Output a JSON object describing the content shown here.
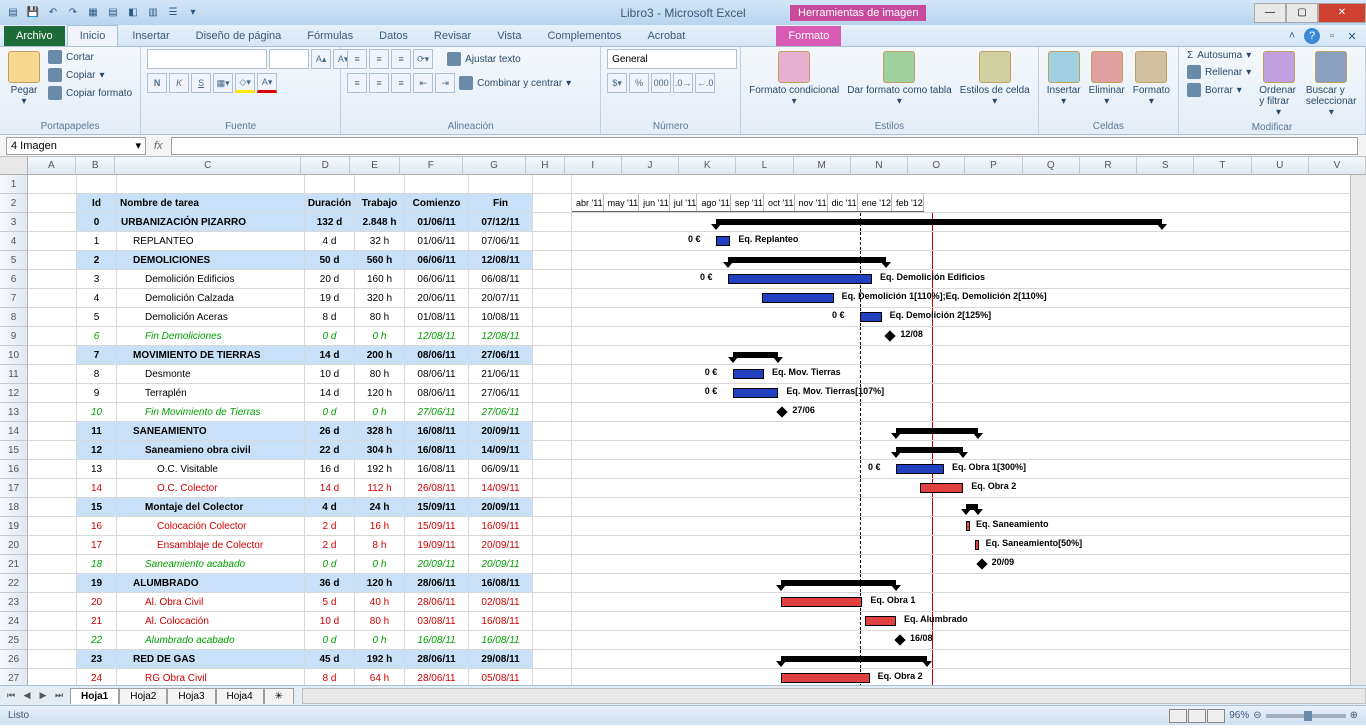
{
  "app": {
    "title": "Libro3 - Microsoft Excel",
    "tools_tab": "Herramientas de imagen"
  },
  "tabs": {
    "file": "Archivo",
    "list": [
      "Inicio",
      "Insertar",
      "Diseño de página",
      "Fórmulas",
      "Datos",
      "Revisar",
      "Vista",
      "Complementos",
      "Acrobat"
    ],
    "contextual": "Formato"
  },
  "ribbon": {
    "clipboard": {
      "paste": "Pegar",
      "cut": "Cortar",
      "copy": "Copiar",
      "format_painter": "Copiar formato",
      "label": "Portapapeles"
    },
    "font": {
      "label": "Fuente"
    },
    "alignment": {
      "wrap": "Ajustar texto",
      "merge": "Combinar y centrar",
      "label": "Alineación"
    },
    "number": {
      "format": "General",
      "label": "Número"
    },
    "styles": {
      "cond": "Formato condicional",
      "table": "Dar formato como tabla",
      "cell": "Estilos de celda",
      "label": "Estilos"
    },
    "cells": {
      "insert": "Insertar",
      "delete": "Eliminar",
      "format": "Formato",
      "label": "Celdas"
    },
    "editing": {
      "autosum": "Autosuma",
      "fill": "Rellenar",
      "clear": "Borrar",
      "sort": "Ordenar y filtrar",
      "find": "Buscar y seleccionar",
      "label": "Modificar"
    }
  },
  "namebox": "4 Imagen",
  "fx": "fx",
  "columns": [
    "A",
    "B",
    "C",
    "D",
    "E",
    "F",
    "G",
    "H",
    "I",
    "J",
    "K",
    "L",
    "M",
    "N",
    "O",
    "P",
    "Q",
    "R",
    "S",
    "T",
    "U",
    "V"
  ],
  "tbl_header": {
    "id": "Id",
    "name": "Nombre de tarea",
    "dur": "Duración",
    "work": "Trabajo",
    "start": "Comienzo",
    "fin": "Fin"
  },
  "tasks": [
    {
      "r": 3,
      "id": "0",
      "name": "URBANIZACIÓN PIZARRO",
      "dur": "132 d",
      "work": "2.848 h",
      "start": "01/06/11",
      "fin": "07/12/11",
      "cls": "grp-blue",
      "indent": 0
    },
    {
      "r": 4,
      "id": "1",
      "name": "REPLANTEO",
      "dur": "4 d",
      "work": "32 h",
      "start": "01/06/11",
      "fin": "07/06/11",
      "cls": "",
      "indent": 1
    },
    {
      "r": 5,
      "id": "2",
      "name": "DEMOLICIONES",
      "dur": "50 d",
      "work": "560 h",
      "start": "06/06/11",
      "fin": "12/08/11",
      "cls": "grp-blue",
      "indent": 1
    },
    {
      "r": 6,
      "id": "3",
      "name": "Demolición Edificios",
      "dur": "20 d",
      "work": "160 h",
      "start": "06/06/11",
      "fin": "06/08/11",
      "cls": "",
      "indent": 2
    },
    {
      "r": 7,
      "id": "4",
      "name": "Demolición Calzada",
      "dur": "19 d",
      "work": "320 h",
      "start": "20/06/11",
      "fin": "20/07/11",
      "cls": "",
      "indent": 2
    },
    {
      "r": 8,
      "id": "5",
      "name": "Demolición Aceras",
      "dur": "8 d",
      "work": "80 h",
      "start": "01/08/11",
      "fin": "10/08/11",
      "cls": "",
      "indent": 2
    },
    {
      "r": 9,
      "id": "6",
      "name": "Fin Demoliciones",
      "dur": "0 d",
      "work": "0 h",
      "start": "12/08/11",
      "fin": "12/08/11",
      "cls": "txt-green",
      "indent": 2
    },
    {
      "r": 10,
      "id": "7",
      "name": "MOVIMIENTO DE TIERRAS",
      "dur": "14 d",
      "work": "200 h",
      "start": "08/06/11",
      "fin": "27/06/11",
      "cls": "grp-blue",
      "indent": 1
    },
    {
      "r": 11,
      "id": "8",
      "name": "Desmonte",
      "dur": "10 d",
      "work": "80 h",
      "start": "08/06/11",
      "fin": "21/06/11",
      "cls": "",
      "indent": 2
    },
    {
      "r": 12,
      "id": "9",
      "name": "Terraplén",
      "dur": "14 d",
      "work": "120 h",
      "start": "08/06/11",
      "fin": "27/06/11",
      "cls": "",
      "indent": 2
    },
    {
      "r": 13,
      "id": "10",
      "name": "Fin Movimiento de Tierras",
      "dur": "0 d",
      "work": "0 h",
      "start": "27/06/11",
      "fin": "27/06/11",
      "cls": "txt-green",
      "indent": 2
    },
    {
      "r": 14,
      "id": "11",
      "name": "SANEAMIENTO",
      "dur": "26 d",
      "work": "328 h",
      "start": "16/08/11",
      "fin": "20/09/11",
      "cls": "grp-blue",
      "indent": 1
    },
    {
      "r": 15,
      "id": "12",
      "name": "Saneamieno obra civil",
      "dur": "22 d",
      "work": "304 h",
      "start": "16/08/11",
      "fin": "14/09/11",
      "cls": "grp-blue",
      "indent": 2
    },
    {
      "r": 16,
      "id": "13",
      "name": "O.C. Visitable",
      "dur": "16 d",
      "work": "192 h",
      "start": "16/08/11",
      "fin": "06/09/11",
      "cls": "",
      "indent": 3
    },
    {
      "r": 17,
      "id": "14",
      "name": "O.C. Colector",
      "dur": "14 d",
      "work": "112 h",
      "start": "26/08/11",
      "fin": "14/09/11",
      "cls": "txt-red",
      "indent": 3
    },
    {
      "r": 18,
      "id": "15",
      "name": "Montaje del Colector",
      "dur": "4 d",
      "work": "24 h",
      "start": "15/09/11",
      "fin": "20/09/11",
      "cls": "grp-blue",
      "indent": 2
    },
    {
      "r": 19,
      "id": "16",
      "name": "Colocación Colector",
      "dur": "2 d",
      "work": "16 h",
      "start": "15/09/11",
      "fin": "16/09/11",
      "cls": "txt-red",
      "indent": 3
    },
    {
      "r": 20,
      "id": "17",
      "name": "Ensamblaje de Colector",
      "dur": "2 d",
      "work": "8 h",
      "start": "19/09/11",
      "fin": "20/09/11",
      "cls": "txt-red",
      "indent": 3
    },
    {
      "r": 21,
      "id": "18",
      "name": "Saneamiento acabado",
      "dur": "0 d",
      "work": "0 h",
      "start": "20/09/11",
      "fin": "20/09/11",
      "cls": "txt-green",
      "indent": 2
    },
    {
      "r": 22,
      "id": "19",
      "name": "ALUMBRADO",
      "dur": "36 d",
      "work": "120 h",
      "start": "28/06/11",
      "fin": "16/08/11",
      "cls": "grp-blue",
      "indent": 1
    },
    {
      "r": 23,
      "id": "20",
      "name": "Al. Obra Civil",
      "dur": "5 d",
      "work": "40 h",
      "start": "28/06/11",
      "fin": "02/08/11",
      "cls": "txt-red",
      "indent": 2
    },
    {
      "r": 24,
      "id": "21",
      "name": "Al. Colocación",
      "dur": "10 d",
      "work": "80 h",
      "start": "03/08/11",
      "fin": "16/08/11",
      "cls": "txt-red",
      "indent": 2
    },
    {
      "r": 25,
      "id": "22",
      "name": "Alumbrado acabado",
      "dur": "0 d",
      "work": "0 h",
      "start": "16/08/11",
      "fin": "16/08/11",
      "cls": "txt-green",
      "indent": 2
    },
    {
      "r": 26,
      "id": "23",
      "name": "RED DE GAS",
      "dur": "45 d",
      "work": "192 h",
      "start": "28/06/11",
      "fin": "29/08/11",
      "cls": "grp-blue",
      "indent": 1
    },
    {
      "r": 27,
      "id": "24",
      "name": "RG Obra Civil",
      "dur": "8 d",
      "work": "64 h",
      "start": "28/06/11",
      "fin": "05/08/11",
      "cls": "txt-red",
      "indent": 2
    }
  ],
  "months": [
    "abr '11",
    "may '11",
    "jun '11",
    "jul '11",
    "ago '11",
    "sep '11",
    "oct '11",
    "nov '11",
    "dic '11",
    "ene '12",
    "feb '12"
  ],
  "gantt_labels": {
    "replanteo": "Eq. Replanteo",
    "dem_edif": "Eq. Demolición Edificios",
    "dem_calz": "Eq. Demolición 1[110%];Eq. Demolición 2[110%]",
    "dem_acer": "Eq. Demolición 2[125%]",
    "fin_dem": "12/08",
    "desmonte": "Eq. Mov. Tierras",
    "terraplen": "Eq. Mov. Tierras[107%]",
    "fin_mov": "27/06",
    "oc_vis": "Eq. Obra 1[300%]",
    "oc_col": "Eq. Obra 2",
    "coloc_col": "Eq. Saneamiento",
    "ensam_col": "Eq. Saneamiento[50%]",
    "san_fin": "20/09",
    "al_oc": "Eq. Obra 1",
    "al_coloc": "Eq. Alumbrado",
    "al_fin": "16/08",
    "rg_oc": "Eq. Obra 2",
    "cost": "0 €"
  },
  "sheets": [
    "Hoja1",
    "Hoja2",
    "Hoja3",
    "Hoja4"
  ],
  "status": {
    "ready": "Listo",
    "zoom": "96%"
  }
}
